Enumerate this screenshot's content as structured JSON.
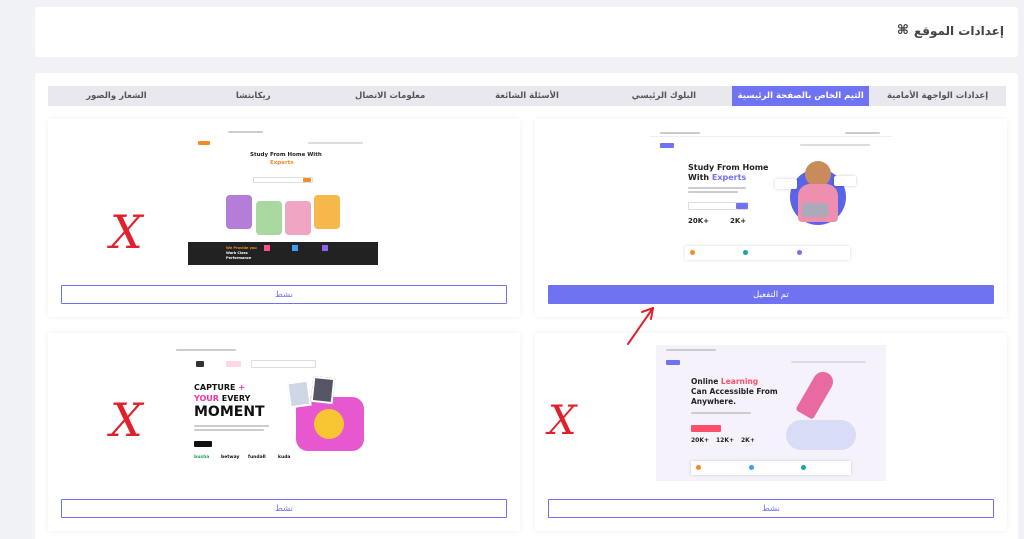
{
  "header": {
    "title": "إعدادات الموقع",
    "icon": "command-icon"
  },
  "tabs": [
    {
      "label": "إعدادات الواجهة الأمامية",
      "active": false
    },
    {
      "label": "الثيم الخاص بالصفحة الرئيسية",
      "active": true
    },
    {
      "label": "البلوك الرئيسي",
      "active": false
    },
    {
      "label": "الأسئلة الشائعة",
      "active": false
    },
    {
      "label": "معلومات الاتصال",
      "active": false
    },
    {
      "label": "ريكابتشا",
      "active": false
    },
    {
      "label": "الشعار والصور",
      "active": false
    }
  ],
  "themes": {
    "theme1": {
      "button_label": "تم التفعيل",
      "heading_line1": "Study From Home",
      "heading_line2": "With",
      "heading_accent": "Experts",
      "stat1": "20K+",
      "stat2": "2K+"
    },
    "theme2": {
      "button_label": "نشط",
      "heading_line1": "Study From Home With",
      "heading_accent": "Experts",
      "footer_text1": "We Provide you",
      "footer_text2": "Work Class",
      "footer_text3": "Performance"
    },
    "theme3": {
      "button_label": "نشط",
      "heading_line1_a": "Online",
      "heading_line1_b": "Learning",
      "heading_line2": "Can Accessible From",
      "heading_line3": "Anywhere.",
      "stat1": "20K+",
      "stat2": "12K+",
      "stat3": "2K+"
    },
    "theme4": {
      "button_label": "نشط",
      "heading_line1_a": "CAPTURE",
      "heading_line1_b": "+",
      "heading_line2_a": "YOUR",
      "heading_line2_b": "EVERY",
      "heading_line3": "MOMENT",
      "brands": [
        "busha",
        "betway",
        "fundall",
        "kuda"
      ]
    }
  },
  "annotations": {
    "mark": "X"
  },
  "colors": {
    "accent": "#6f73f2",
    "red": "#e0202a",
    "orange": "#f28c28",
    "pink": "#ff4f8b"
  }
}
